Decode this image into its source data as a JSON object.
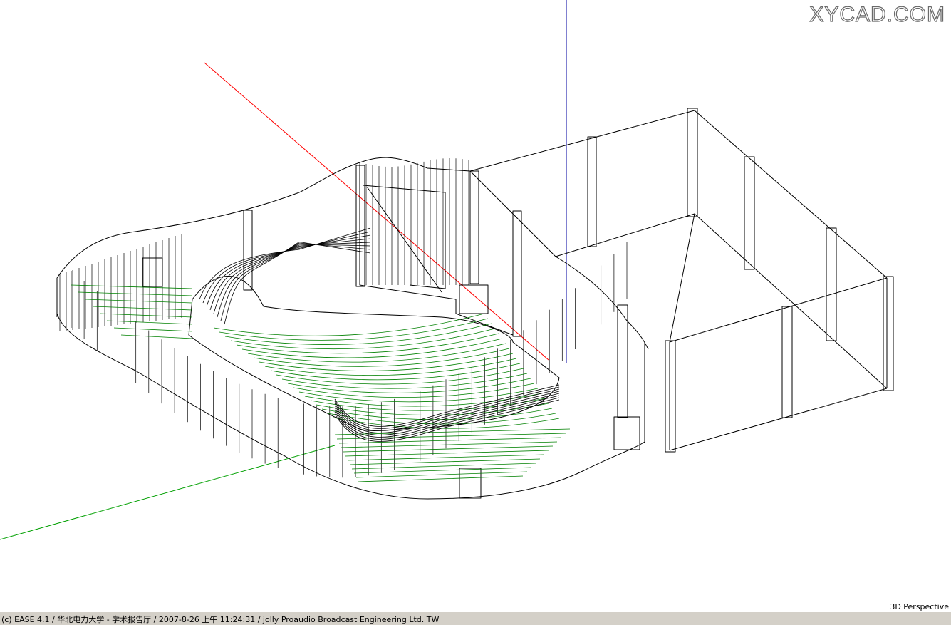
{
  "watermark": "XYCAD.COM",
  "viewport": {
    "view_label": "3D Perspective",
    "axis_colors": {
      "x": "#ff0000",
      "y": "#00a000",
      "z": "#0000a0"
    },
    "wire_colors": {
      "structure": "#000000",
      "seating": "#008000"
    }
  },
  "status_bar": {
    "text": "(c) EASE 4.1  / 华北电力大学 - 学术报告厅  / 2007-8-26 上午 11:24:31 / jolly Proaudio Broadcast Engineering Ltd. TW"
  }
}
